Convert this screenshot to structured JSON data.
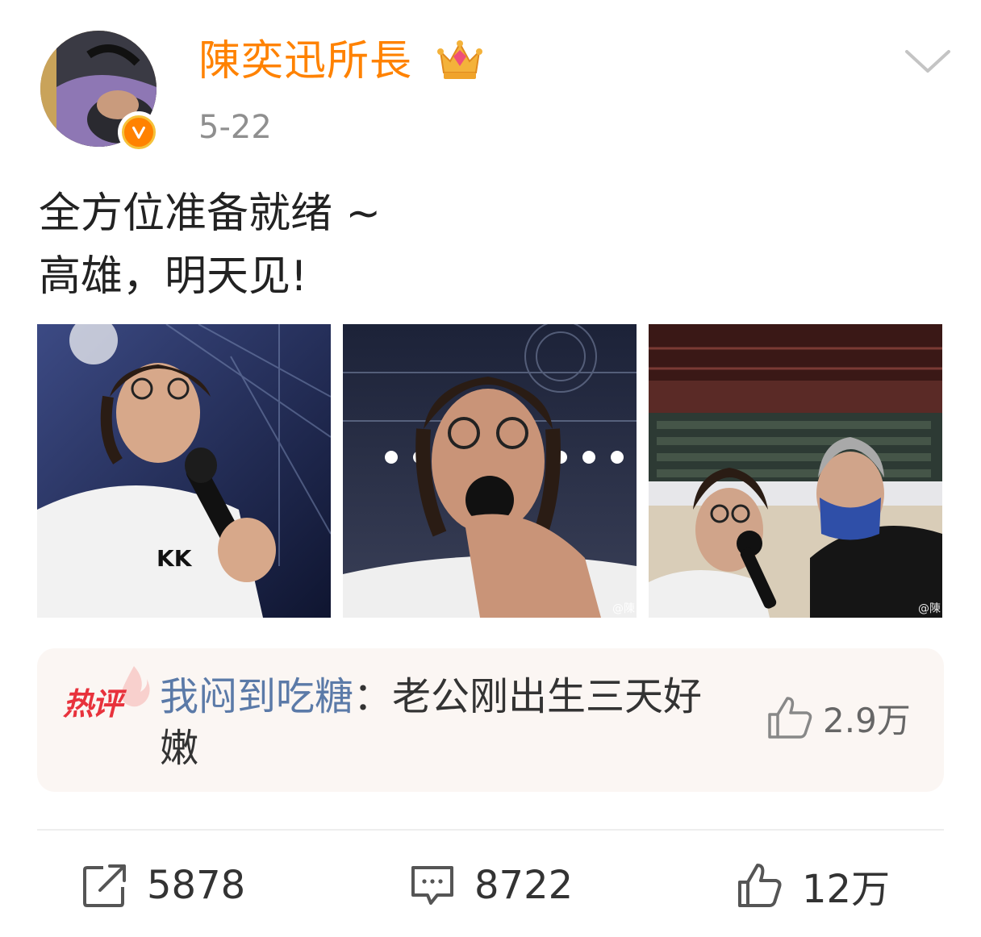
{
  "header": {
    "username": "陳奕迅所長",
    "date": "5-22",
    "menu_icon": "chevron-down-icon",
    "avatar_icon": "avatar",
    "verified_icon": "verified-v-icon",
    "member_icon": "crown-icon"
  },
  "post": {
    "lines": [
      "全方位准备就绪 ~",
      "高雄，明天见!"
    ]
  },
  "photos": {
    "watermark": "@陳"
  },
  "hot_comment": {
    "badge": "热评",
    "author": "我闷到吃糖",
    "separator": "：",
    "text": "老公刚出生三天好嫩",
    "likes": "2.9万"
  },
  "actions": {
    "repost_count": "5878",
    "comment_count": "8722",
    "like_count": "12万"
  },
  "colors": {
    "username": "#ff8200",
    "comment_author": "#5b7aa8",
    "hot_badge": "#e8323c",
    "comment_bg": "#fbf6f3"
  }
}
